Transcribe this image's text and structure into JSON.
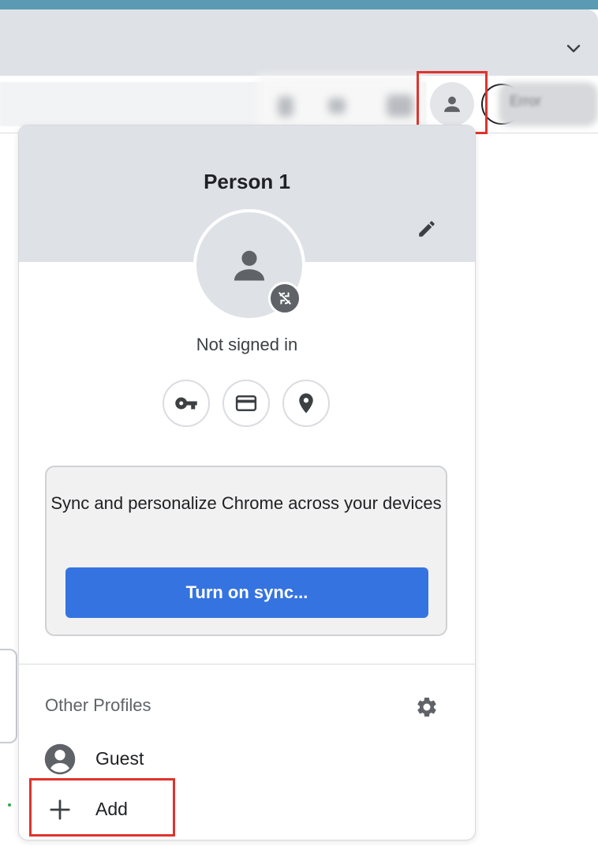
{
  "browser": {
    "tab_chevron_icon": "chevron-down-icon",
    "profile_button_icon": "person-icon",
    "blurred_button_text": "Error"
  },
  "profile_menu": {
    "name": "Person 1",
    "edit_icon": "pencil-icon",
    "avatar_icon": "person-icon",
    "sync_badge_icon": "sync-disabled-icon",
    "status": "Not signed in",
    "quick_actions": [
      {
        "name": "passwords",
        "icon": "key-icon"
      },
      {
        "name": "payment-methods",
        "icon": "credit-card-icon"
      },
      {
        "name": "addresses",
        "icon": "location-pin-icon"
      }
    ],
    "sync_promo": {
      "text": "Sync and personalize Chrome across your devices",
      "button_label": "Turn on sync..."
    },
    "other_profiles": {
      "label": "Other Profiles",
      "settings_icon": "gear-icon",
      "items": [
        {
          "label": "Guest",
          "icon": "account-circle-icon"
        },
        {
          "label": "Add",
          "icon": "plus-icon"
        }
      ]
    }
  },
  "colors": {
    "highlight": "#e0332c",
    "primary_button": "#3573e0",
    "header_bg": "#dee1e6",
    "icon_gray": "#5f6368"
  }
}
